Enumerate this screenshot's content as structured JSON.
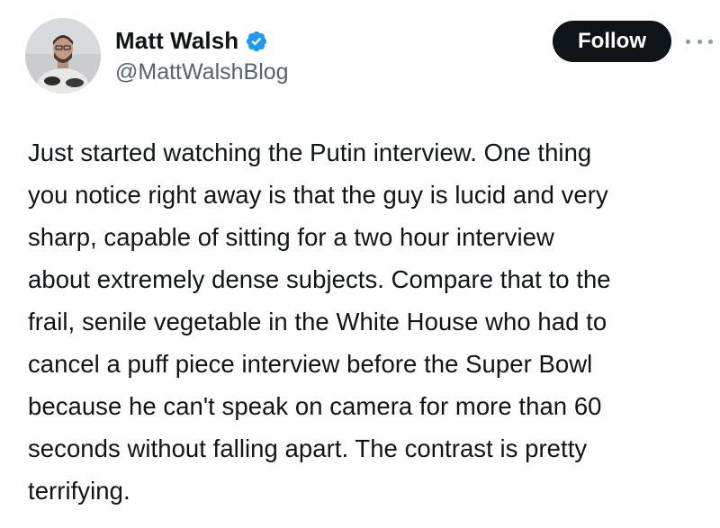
{
  "author": {
    "display_name": "Matt Walsh",
    "handle": "@MattWalshBlog",
    "verified": true,
    "avatar_icon": "profile-photo"
  },
  "actions": {
    "follow_label": "Follow",
    "more_icon": "more-options-icon"
  },
  "tweet": {
    "text": "Just started watching the Putin interview. One thing\nyou notice right away is that the guy is lucid and very\nsharp, capable of sitting for a two hour interview\nabout extremely dense subjects. Compare that to the\nfrail, senile vegetable in the White House who had to\ncancel a puff piece interview before the Super Bowl\nbecause he can't speak on camera for more than 60\nseconds without falling apart. The contrast is pretty\nterrifying."
  },
  "colors": {
    "text_primary": "#0f1419",
    "text_secondary": "#536471",
    "verified_blue": "#1d9bf0",
    "follow_bg": "#0f1419",
    "follow_fg": "#ffffff"
  }
}
